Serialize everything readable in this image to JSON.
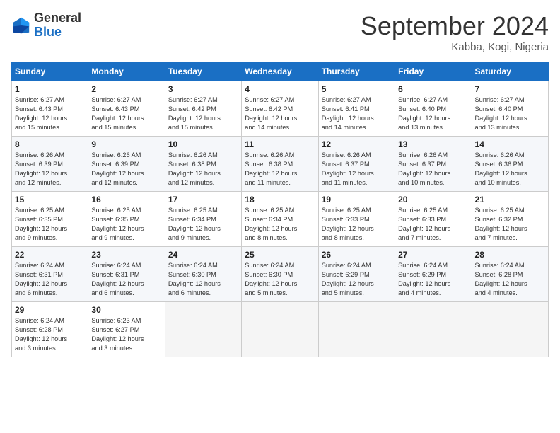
{
  "logo": {
    "general": "General",
    "blue": "Blue"
  },
  "title": "September 2024",
  "location": "Kabba, Kogi, Nigeria",
  "days_header": [
    "Sunday",
    "Monday",
    "Tuesday",
    "Wednesday",
    "Thursday",
    "Friday",
    "Saturday"
  ],
  "weeks": [
    [
      {
        "day": "1",
        "info": "Sunrise: 6:27 AM\nSunset: 6:43 PM\nDaylight: 12 hours\nand 15 minutes."
      },
      {
        "day": "2",
        "info": "Sunrise: 6:27 AM\nSunset: 6:43 PM\nDaylight: 12 hours\nand 15 minutes."
      },
      {
        "day": "3",
        "info": "Sunrise: 6:27 AM\nSunset: 6:42 PM\nDaylight: 12 hours\nand 15 minutes."
      },
      {
        "day": "4",
        "info": "Sunrise: 6:27 AM\nSunset: 6:42 PM\nDaylight: 12 hours\nand 14 minutes."
      },
      {
        "day": "5",
        "info": "Sunrise: 6:27 AM\nSunset: 6:41 PM\nDaylight: 12 hours\nand 14 minutes."
      },
      {
        "day": "6",
        "info": "Sunrise: 6:27 AM\nSunset: 6:40 PM\nDaylight: 12 hours\nand 13 minutes."
      },
      {
        "day": "7",
        "info": "Sunrise: 6:27 AM\nSunset: 6:40 PM\nDaylight: 12 hours\nand 13 minutes."
      }
    ],
    [
      {
        "day": "8",
        "info": "Sunrise: 6:26 AM\nSunset: 6:39 PM\nDaylight: 12 hours\nand 12 minutes."
      },
      {
        "day": "9",
        "info": "Sunrise: 6:26 AM\nSunset: 6:39 PM\nDaylight: 12 hours\nand 12 minutes."
      },
      {
        "day": "10",
        "info": "Sunrise: 6:26 AM\nSunset: 6:38 PM\nDaylight: 12 hours\nand 12 minutes."
      },
      {
        "day": "11",
        "info": "Sunrise: 6:26 AM\nSunset: 6:38 PM\nDaylight: 12 hours\nand 11 minutes."
      },
      {
        "day": "12",
        "info": "Sunrise: 6:26 AM\nSunset: 6:37 PM\nDaylight: 12 hours\nand 11 minutes."
      },
      {
        "day": "13",
        "info": "Sunrise: 6:26 AM\nSunset: 6:37 PM\nDaylight: 12 hours\nand 10 minutes."
      },
      {
        "day": "14",
        "info": "Sunrise: 6:26 AM\nSunset: 6:36 PM\nDaylight: 12 hours\nand 10 minutes."
      }
    ],
    [
      {
        "day": "15",
        "info": "Sunrise: 6:25 AM\nSunset: 6:35 PM\nDaylight: 12 hours\nand 9 minutes."
      },
      {
        "day": "16",
        "info": "Sunrise: 6:25 AM\nSunset: 6:35 PM\nDaylight: 12 hours\nand 9 minutes."
      },
      {
        "day": "17",
        "info": "Sunrise: 6:25 AM\nSunset: 6:34 PM\nDaylight: 12 hours\nand 9 minutes."
      },
      {
        "day": "18",
        "info": "Sunrise: 6:25 AM\nSunset: 6:34 PM\nDaylight: 12 hours\nand 8 minutes."
      },
      {
        "day": "19",
        "info": "Sunrise: 6:25 AM\nSunset: 6:33 PM\nDaylight: 12 hours\nand 8 minutes."
      },
      {
        "day": "20",
        "info": "Sunrise: 6:25 AM\nSunset: 6:33 PM\nDaylight: 12 hours\nand 7 minutes."
      },
      {
        "day": "21",
        "info": "Sunrise: 6:25 AM\nSunset: 6:32 PM\nDaylight: 12 hours\nand 7 minutes."
      }
    ],
    [
      {
        "day": "22",
        "info": "Sunrise: 6:24 AM\nSunset: 6:31 PM\nDaylight: 12 hours\nand 6 minutes."
      },
      {
        "day": "23",
        "info": "Sunrise: 6:24 AM\nSunset: 6:31 PM\nDaylight: 12 hours\nand 6 minutes."
      },
      {
        "day": "24",
        "info": "Sunrise: 6:24 AM\nSunset: 6:30 PM\nDaylight: 12 hours\nand 6 minutes."
      },
      {
        "day": "25",
        "info": "Sunrise: 6:24 AM\nSunset: 6:30 PM\nDaylight: 12 hours\nand 5 minutes."
      },
      {
        "day": "26",
        "info": "Sunrise: 6:24 AM\nSunset: 6:29 PM\nDaylight: 12 hours\nand 5 minutes."
      },
      {
        "day": "27",
        "info": "Sunrise: 6:24 AM\nSunset: 6:29 PM\nDaylight: 12 hours\nand 4 minutes."
      },
      {
        "day": "28",
        "info": "Sunrise: 6:24 AM\nSunset: 6:28 PM\nDaylight: 12 hours\nand 4 minutes."
      }
    ],
    [
      {
        "day": "29",
        "info": "Sunrise: 6:24 AM\nSunset: 6:28 PM\nDaylight: 12 hours\nand 3 minutes."
      },
      {
        "day": "30",
        "info": "Sunrise: 6:23 AM\nSunset: 6:27 PM\nDaylight: 12 hours\nand 3 minutes."
      },
      {
        "day": "",
        "info": ""
      },
      {
        "day": "",
        "info": ""
      },
      {
        "day": "",
        "info": ""
      },
      {
        "day": "",
        "info": ""
      },
      {
        "day": "",
        "info": ""
      }
    ]
  ]
}
